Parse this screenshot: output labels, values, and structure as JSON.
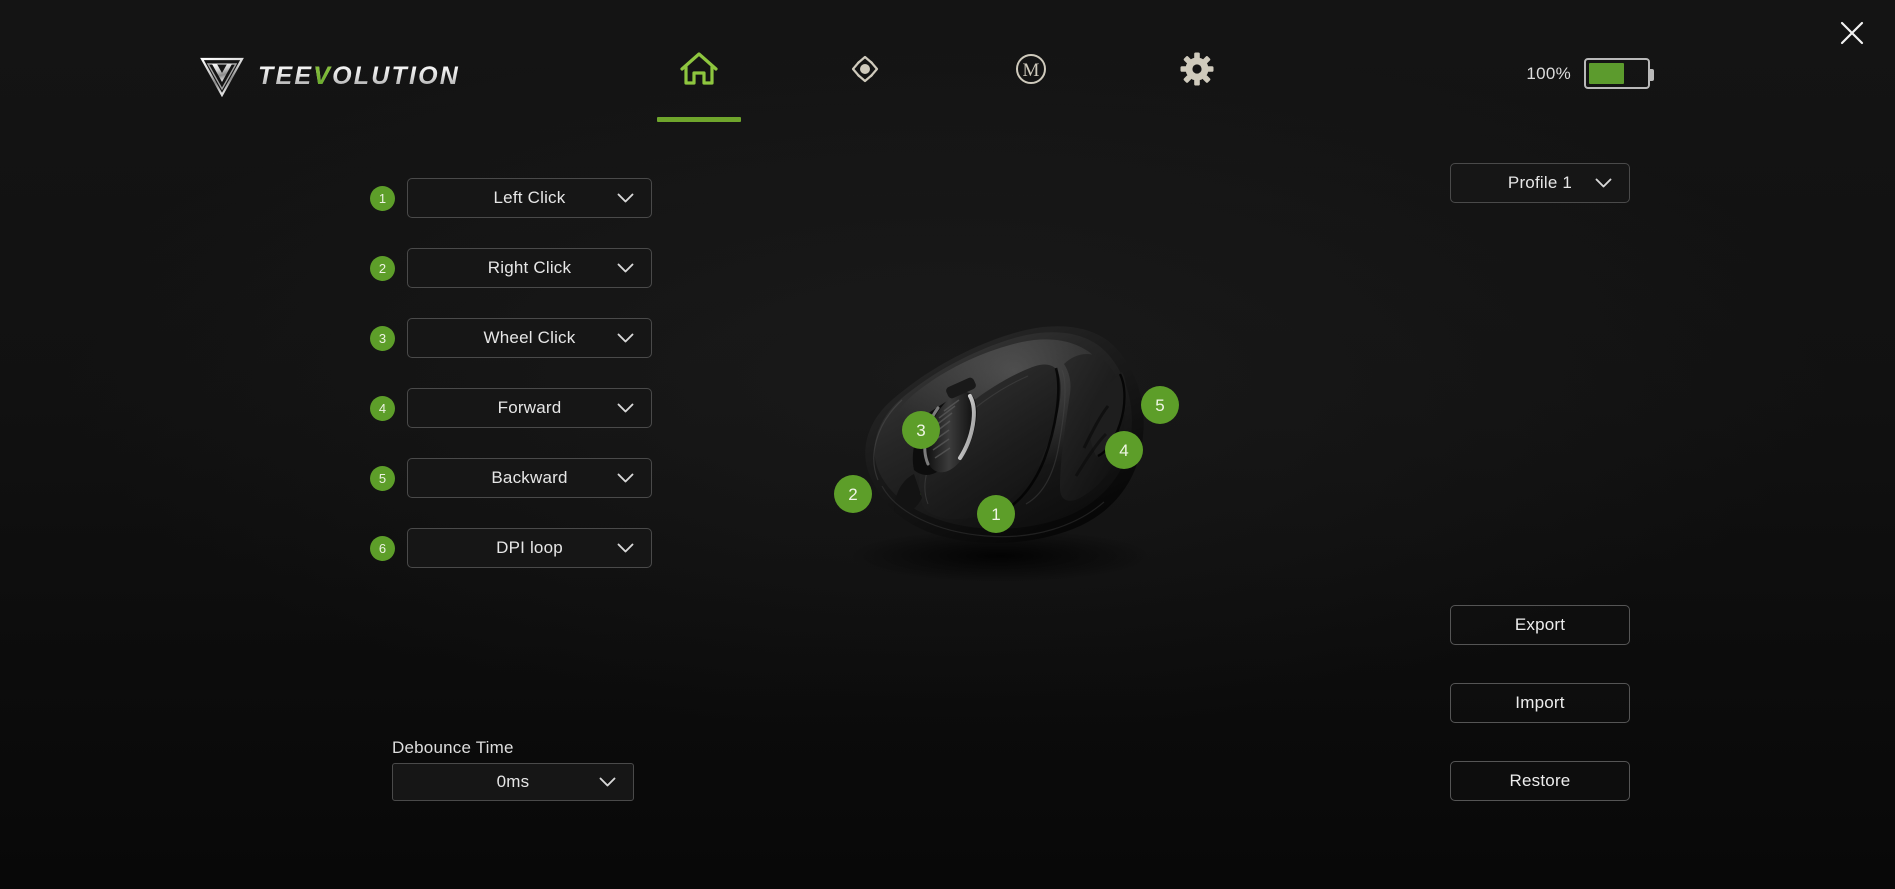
{
  "app": {
    "brand_primary": "TEE",
    "brand_accent": "V",
    "brand_suffix": "OLUTION",
    "accent_color": "#5d9e29",
    "background_color": "#141414"
  },
  "header": {
    "logo_icon": "triangle-v-emblem-icon",
    "close_icon": "close-x-icon",
    "nav": [
      {
        "id": "home",
        "icon": "home-icon",
        "active": true
      },
      {
        "id": "sensitivity",
        "icon": "dpi-crosshair-icon",
        "active": false
      },
      {
        "id": "macro",
        "icon": "macro-m-icon",
        "active": false
      },
      {
        "id": "settings",
        "icon": "gear-icon",
        "active": false
      }
    ],
    "battery": {
      "percent_label": "100%",
      "fill_percent": 62,
      "icon": "battery-icon"
    }
  },
  "profile": {
    "label": "Profile 1",
    "chevron_icon": "chevron-down-icon"
  },
  "buttons_panel": {
    "chevron_icon": "chevron-down-icon",
    "rows": [
      {
        "number": "1",
        "assignment": "Left Click"
      },
      {
        "number": "2",
        "assignment": "Right Click"
      },
      {
        "number": "3",
        "assignment": "Wheel Click"
      },
      {
        "number": "4",
        "assignment": "Forward"
      },
      {
        "number": "5",
        "assignment": "Backward"
      },
      {
        "number": "6",
        "assignment": "DPI loop"
      }
    ]
  },
  "debounce": {
    "label": "Debounce Time",
    "value": "0ms",
    "chevron_icon": "chevron-down-icon"
  },
  "actions": [
    {
      "id": "export",
      "label": "Export"
    },
    {
      "id": "import",
      "label": "Import"
    },
    {
      "id": "restore",
      "label": "Restore"
    }
  ],
  "mouse_diagram": {
    "device_icon": "gaming-mouse-icon",
    "hotspots": [
      {
        "number": "1",
        "target": "left-click-button"
      },
      {
        "number": "2",
        "target": "right-click-button"
      },
      {
        "number": "3",
        "target": "scroll-wheel"
      },
      {
        "number": "4",
        "target": "side-forward-button"
      },
      {
        "number": "5",
        "target": "side-backward-button"
      }
    ]
  }
}
